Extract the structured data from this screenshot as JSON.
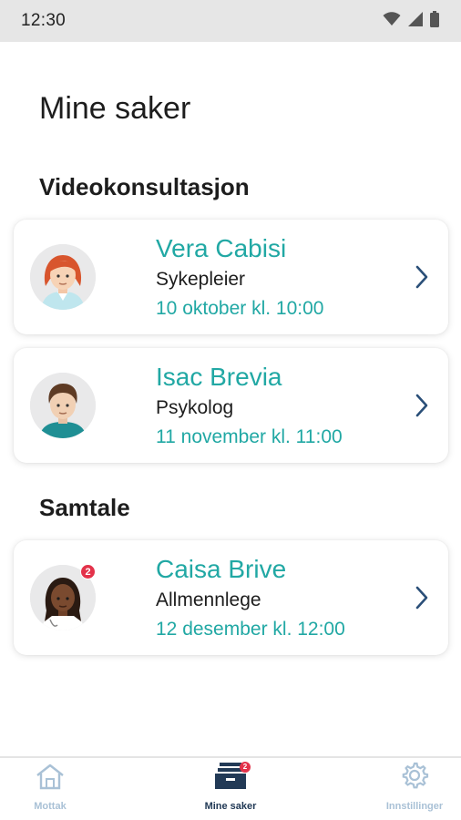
{
  "status_bar": {
    "time": "12:30",
    "icons": [
      "wifi-icon",
      "signal-icon",
      "battery-icon"
    ]
  },
  "page_title": "Mine saker",
  "sections": [
    {
      "title": "Videokonsultasjon",
      "cases": [
        {
          "name": "Vera Cabisi",
          "role": "Sykepleier",
          "datetime": "10 oktober kl. 10:00",
          "avatar": "nurse-avatar-icon",
          "badge": null
        },
        {
          "name": "Isac Brevia",
          "role": "Psykolog",
          "datetime": "11 november kl. 11:00",
          "avatar": "psychologist-avatar-icon",
          "badge": null
        }
      ]
    },
    {
      "title": "Samtale",
      "cases": [
        {
          "name": "Caisa Brive",
          "role": "Allmennlege",
          "datetime": "12 desember kl. 12:00",
          "avatar": "doctor-avatar-icon",
          "badge": "2"
        }
      ]
    }
  ],
  "bottom_nav": {
    "items": [
      {
        "label": "Mottak",
        "icon": "house-icon",
        "active": false
      },
      {
        "label": "Mine saker",
        "icon": "inbox-tray-icon",
        "active": true,
        "badge": "2"
      },
      {
        "label": "Innstillinger",
        "icon": "gear-icon",
        "active": false
      }
    ]
  },
  "colors": {
    "accent": "#21a8a4",
    "chevron": "#2a4f78",
    "badge": "#e3324a",
    "nav_active": "#223a56",
    "nav_inactive": "#a9c1d6",
    "status_bar_bg": "#e6e6e6"
  }
}
